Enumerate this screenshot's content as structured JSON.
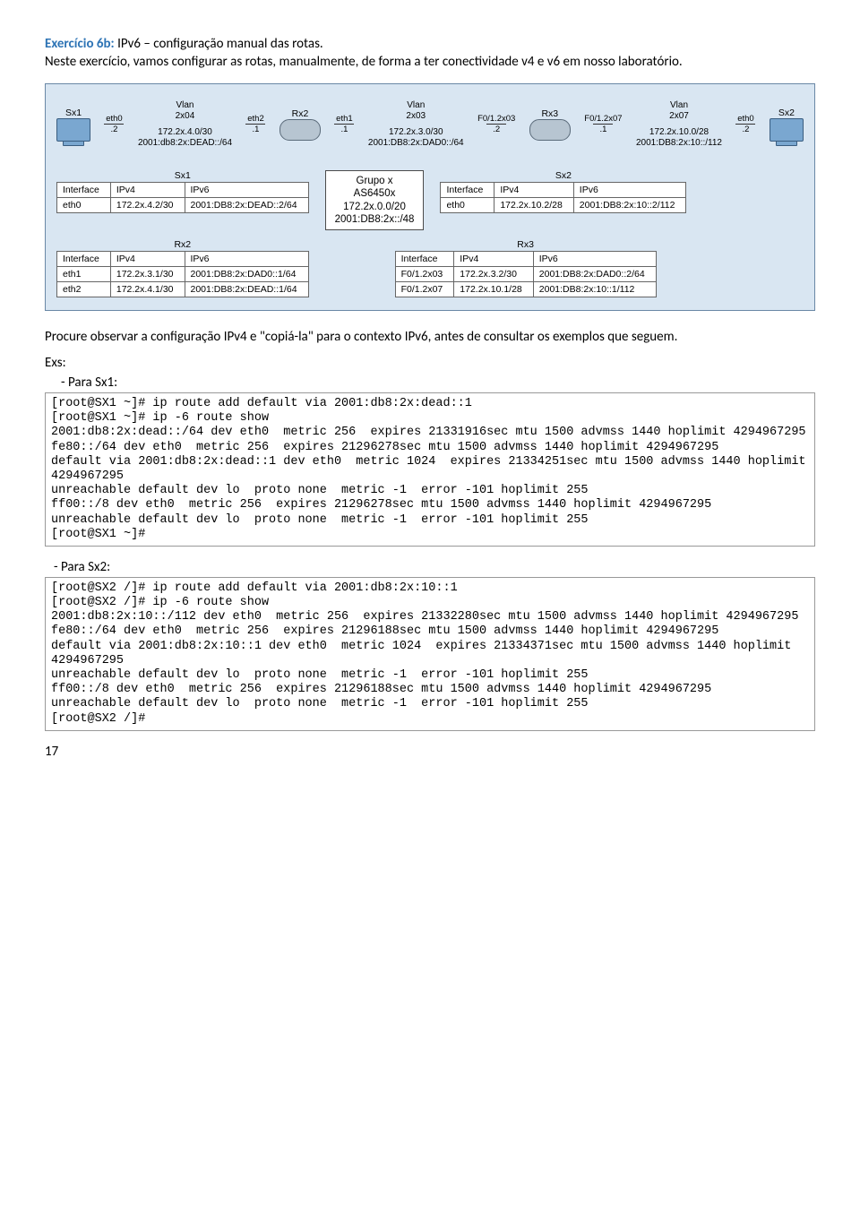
{
  "title_prefix": "Exercício 6b:",
  "title_rest": "  IPv6 – configuração manual das rotas.",
  "intro": "Neste exercício, vamos configurar as rotas, manualmente, de forma a ter conectividade v4 e v6 em nosso laboratório.",
  "topology": {
    "sx1": {
      "name": "Sx1",
      "port": "eth0",
      "portnum": ".2"
    },
    "vlan2x04": {
      "name": "Vlan",
      "id": "2x04",
      "net4": "172.2x.4.0/30",
      "net6": "2001:db8:2x:DEAD::/64"
    },
    "rx2": {
      "name": "Rx2",
      "left_port": "eth2",
      "left_num": ".1",
      "right_port": "eth1",
      "right_num": ".1"
    },
    "vlan2x03": {
      "name": "Vlan",
      "id": "2x03",
      "net4": "172.2x.3.0/30",
      "net6": "2001:DB8:2x:DAD0::/64"
    },
    "rx3": {
      "name": "Rx3",
      "leftp": "F0/1.2x03",
      "leftn": ".2",
      "rightp": "F0/1.2x07",
      "rightn": ".1"
    },
    "vlan2x07": {
      "name": "Vlan",
      "id": "2x07",
      "net4": "172.2x.10.0/28",
      "net6": "2001:DB8:2x:10::/112"
    },
    "sx2": {
      "name": "Sx2",
      "port": "eth0",
      "portnum": ".2"
    }
  },
  "tbl_sx1": {
    "caption": "Sx1",
    "h1": "Interface",
    "h2": "IPv4",
    "h3": "IPv6",
    "r1c1": "eth0",
    "r1c2": "172.2x.4.2/30",
    "r1c3": "2001:DB8:2x:DEAD::2/64"
  },
  "tbl_sx2": {
    "caption": "Sx2",
    "h1": "Interface",
    "h2": "IPv4",
    "h3": "IPv6",
    "r1c1": "eth0",
    "r1c2": "172.2x.10.2/28",
    "r1c3": "2001:DB8:2x:10::2/112"
  },
  "group": {
    "l1": "Grupo x",
    "l2": "AS6450x",
    "l3": "172.2x.0.0/20",
    "l4": "2001:DB8:2x::/48"
  },
  "tbl_rx2": {
    "caption": "Rx2",
    "h1": "Interface",
    "h2": "IPv4",
    "h3": "IPv6",
    "r1c1": "eth1",
    "r1c2": "172.2x.3.1/30",
    "r1c3": "2001:DB8:2x:DAD0::1/64",
    "r2c1": "eth2",
    "r2c2": "172.2x.4.1/30",
    "r2c3": "2001:DB8:2x:DEAD::1/64"
  },
  "tbl_rx3": {
    "caption": "Rx3",
    "h1": "Interface",
    "h2": "IPv4",
    "h3": "IPv6",
    "r1c1": "F0/1.2x03",
    "r1c2": "172.2x.3.2/30",
    "r1c3": "2001:DB8:2x:DAD0::2/64",
    "r2c1": "F0/1.2x07",
    "r2c2": "172.2x.10.1/28",
    "r2c3": "2001:DB8:2x:10::1/112"
  },
  "para2": "Procure observar a configuração IPv4 e \"copiá-la\" para o contexto IPv6, antes de consultar os exemplos que seguem.",
  "exs_label": "Exs:",
  "sx1_label": "- Para Sx1:",
  "code_sx1": "[root@SX1 ~]# ip route add default via 2001:db8:2x:dead::1\n[root@SX1 ~]# ip -6 route show\n2001:db8:2x:dead::/64 dev eth0  metric 256  expires 21331916sec mtu 1500 advmss 1440 hoplimit 4294967295\nfe80::/64 dev eth0  metric 256  expires 21296278sec mtu 1500 advmss 1440 hoplimit 4294967295\ndefault via 2001:db8:2x:dead::1 dev eth0  metric 1024  expires 21334251sec mtu 1500 advmss 1440 hoplimit 4294967295\nunreachable default dev lo  proto none  metric -1  error -101 hoplimit 255\nff00::/8 dev eth0  metric 256  expires 21296278sec mtu 1500 advmss 1440 hoplimit 4294967295\nunreachable default dev lo  proto none  metric -1  error -101 hoplimit 255\n[root@SX1 ~]#",
  "sx2_label": "- Para Sx2:",
  "code_sx2": "[root@SX2 /]# ip route add default via 2001:db8:2x:10::1\n[root@SX2 /]# ip -6 route show\n2001:db8:2x:10::/112 dev eth0  metric 256  expires 21332280sec mtu 1500 advmss 1440 hoplimit 4294967295\nfe80::/64 dev eth0  metric 256  expires 21296188sec mtu 1500 advmss 1440 hoplimit 4294967295\ndefault via 2001:db8:2x:10::1 dev eth0  metric 1024  expires 21334371sec mtu 1500 advmss 1440 hoplimit 4294967295\nunreachable default dev lo  proto none  metric -1  error -101 hoplimit 255\nff00::/8 dev eth0  metric 256  expires 21296188sec mtu 1500 advmss 1440 hoplimit 4294967295\nunreachable default dev lo  proto none  metric -1  error -101 hoplimit 255\n[root@SX2 /]#",
  "page": "17"
}
